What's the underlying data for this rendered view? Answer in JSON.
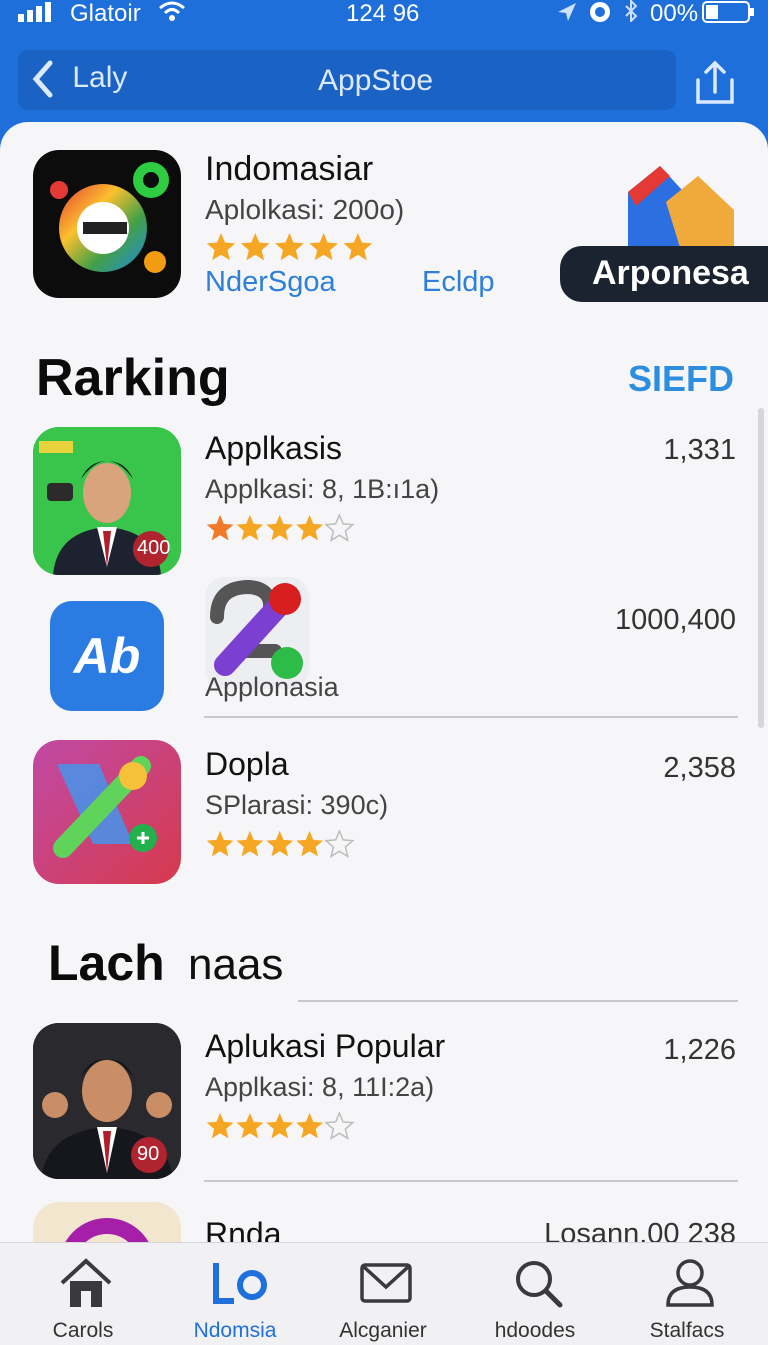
{
  "status_bar": {
    "carrier": "Glatoir",
    "time": "124 96",
    "battery": "00%"
  },
  "nav": {
    "back_label": "Laly",
    "title": "AppStoe"
  },
  "featured": {
    "name": "Indomasiar",
    "subtitle": "Aplolkasi: 200o)",
    "rating": 5,
    "link_left": "NderSgoa",
    "link_right": "Ecldp",
    "badge": "Arponesa"
  },
  "ranking": {
    "heading": "Rarking",
    "see_all": "SIEFD",
    "items": [
      {
        "name": "Applkasis",
        "subtitle": "Applkasi: 8, 1B:ı1a)",
        "count": "1,331",
        "rating": 4,
        "badge": "400"
      },
      {
        "name": "Applonasia",
        "count": "1000,400",
        "icon_text": "Ab"
      },
      {
        "name": "Dopla",
        "subtitle": "SPlarasi: 390c)",
        "count": "2,358",
        "rating": 4
      }
    ]
  },
  "section2": {
    "heading": "Lach",
    "heading_light": "naas",
    "items": [
      {
        "name": "Aplukasi Popular",
        "subtitle": "Applkasi: 8, 11I:2a)",
        "count": "1,226",
        "rating": 4,
        "badge": "90"
      },
      {
        "name": "Rnda",
        "count": "Losann.00 238"
      }
    ]
  },
  "tabs": [
    {
      "label": "Carols"
    },
    {
      "label": "Ndomsia"
    },
    {
      "label": "Alcganier"
    },
    {
      "label": "hdoodes"
    },
    {
      "label": "Stalfacs"
    }
  ],
  "colors": {
    "accent": "#1e6fd9",
    "star": "#f5a623",
    "star_first": "#f07a2a",
    "link": "#2d7fd8"
  }
}
